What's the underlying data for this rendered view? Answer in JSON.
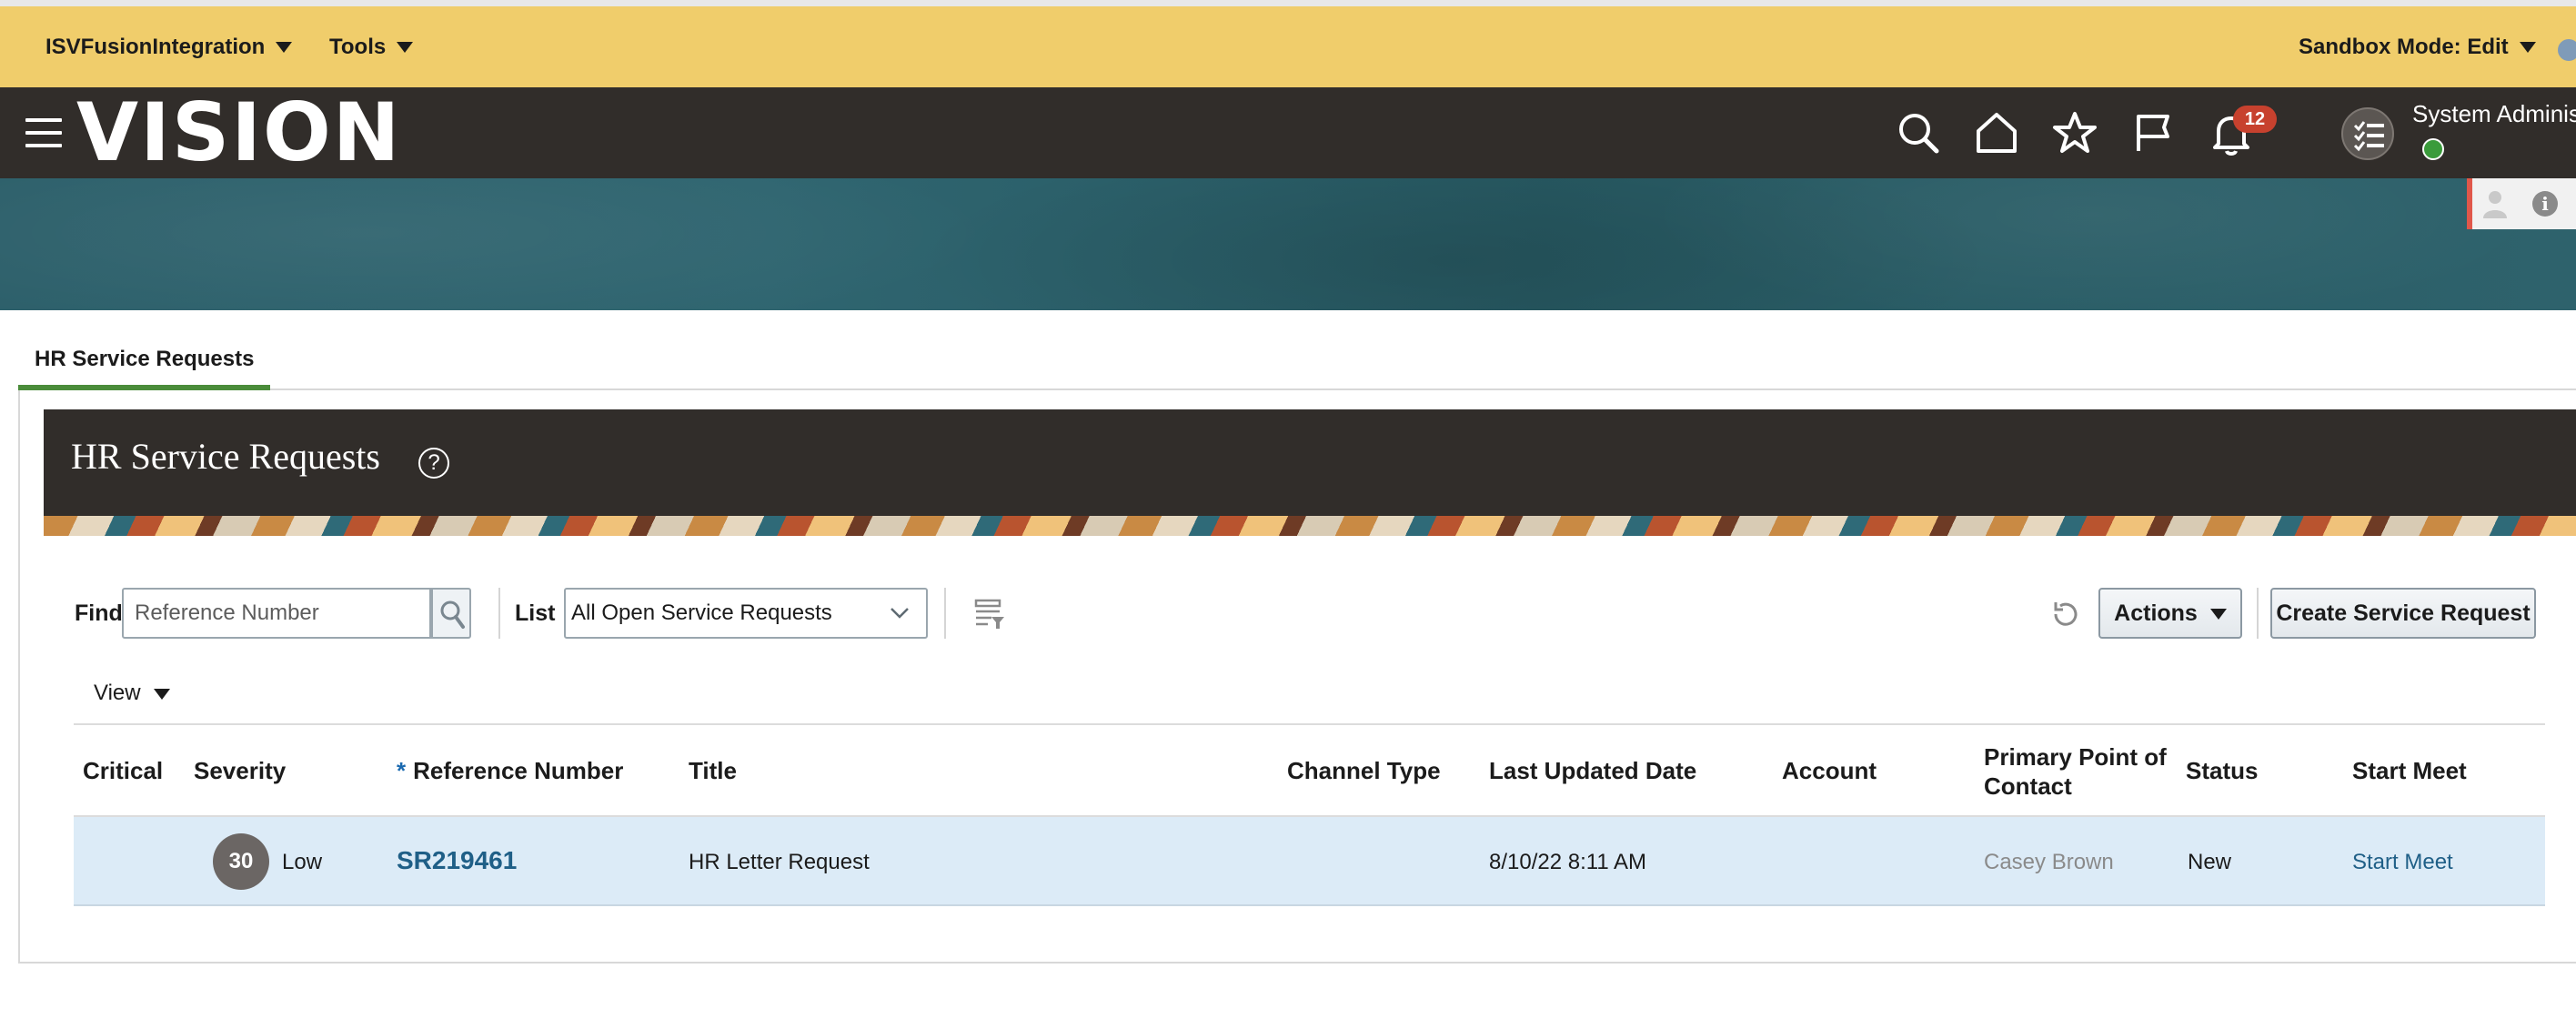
{
  "sandbox_bar": {
    "app_menu": "ISVFusionIntegration",
    "tools_menu": "Tools",
    "sandbox_mode": "Sandbox Mode: Edit"
  },
  "global_header": {
    "logo_text": "VISION",
    "notification_count": "12",
    "user_name": "System Administ",
    "icons": [
      "hamburger-icon",
      "search-icon",
      "home-icon",
      "star-icon",
      "flag-icon",
      "bell-icon",
      "task-list-icon"
    ]
  },
  "tabs": [
    {
      "label": "HR Service Requests",
      "selected": true
    }
  ],
  "page": {
    "title": "HR Service Requests",
    "help_glyph": "?"
  },
  "toolbar": {
    "find_label": "Find",
    "find_placeholder": "Reference Number",
    "list_label": "List",
    "list_value": "All Open Service Requests",
    "actions_label": "Actions",
    "create_label": "Create Service Request",
    "view_label": "View"
  },
  "table": {
    "columns": {
      "critical": "Critical",
      "severity": "Severity",
      "required_marker": "*",
      "reference_number": "Reference Number",
      "title": "Title",
      "channel_type": "Channel Type",
      "last_updated_date": "Last Updated Date",
      "account": "Account",
      "primary_contact": "Primary Point of Contact",
      "status": "Status",
      "start_meet": "Start Meet"
    },
    "rows": [
      {
        "critical": "",
        "severity_score": "30",
        "severity": "Low",
        "reference_number": "SR219461",
        "title": "HR Letter Request",
        "channel_type": "",
        "last_updated_date": "8/10/22 8:11 AM",
        "account": "",
        "primary_contact": "Casey Brown",
        "status": "New",
        "start_meet": "Start Meet"
      }
    ]
  },
  "colors": {
    "sandbox_bar": "#f0cd6b",
    "header_dark": "#312d2a",
    "tab_underline": "#4a8c3a",
    "badge_red": "#c7412e",
    "link_blue": "#1f5f87",
    "row_selected": "#dcebf7"
  }
}
